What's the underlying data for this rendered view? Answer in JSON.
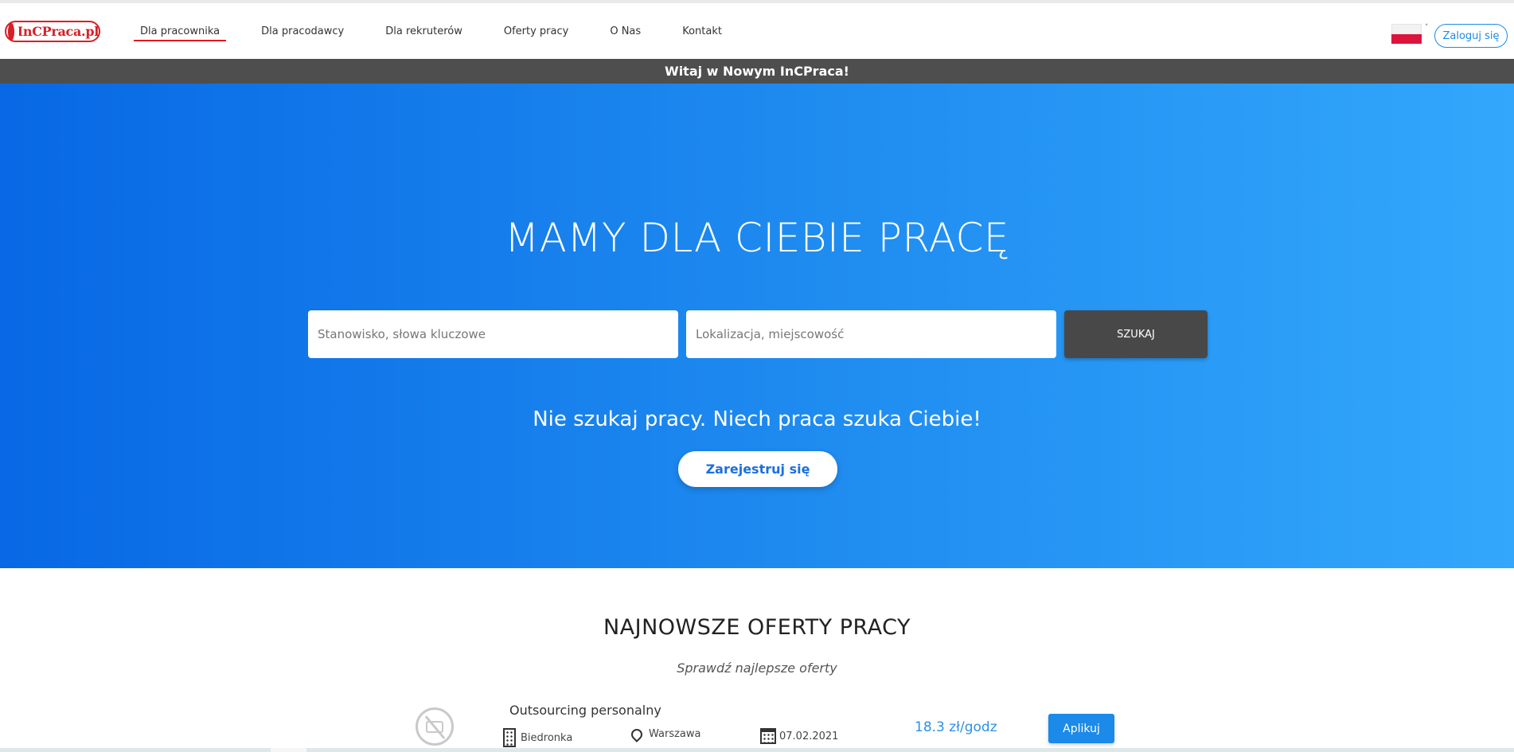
{
  "header": {
    "logo_text": "InCPraca.pl",
    "nav": [
      {
        "label": "Dla pracownika",
        "active": true
      },
      {
        "label": "Dla pracodawcy"
      },
      {
        "label": "Dla rekruterów"
      },
      {
        "label": "Oferty pracy"
      },
      {
        "label": "O Nas"
      },
      {
        "label": "Kontakt"
      }
    ],
    "language_icon": "poland-flag-icon",
    "login_label": "Zaloguj się"
  },
  "banner": {
    "text": "Witaj w Nowym InCPraca!"
  },
  "hero": {
    "title": "MAMY DLA CIEBIE PRACĘ",
    "keyword_placeholder": "Stanowisko, słowa kluczowe",
    "location_placeholder": "Lokalizacja, miejscowość",
    "search_label": "SZUKAJ",
    "tagline": "Nie szukaj pracy. Niech praca szuka Ciebie!",
    "register_label": "Zarejestruj się"
  },
  "offers": {
    "title": "NAJNOWSZE OFERTY PRACY",
    "subtitle": "Sprawdź najlepsze oferty",
    "items": [
      {
        "title": "Outsourcing personalny",
        "company": "Biedronka",
        "city": "Warszawa",
        "date": "07.02.2021",
        "salary": "18.3 zł/godz",
        "apply_label": "Aplikuj"
      }
    ]
  },
  "colors": {
    "brand_red": "#d81f26",
    "accent_blue": "#1b8ae8",
    "banner_gray": "#4e4e4e",
    "search_button": "#484848"
  }
}
